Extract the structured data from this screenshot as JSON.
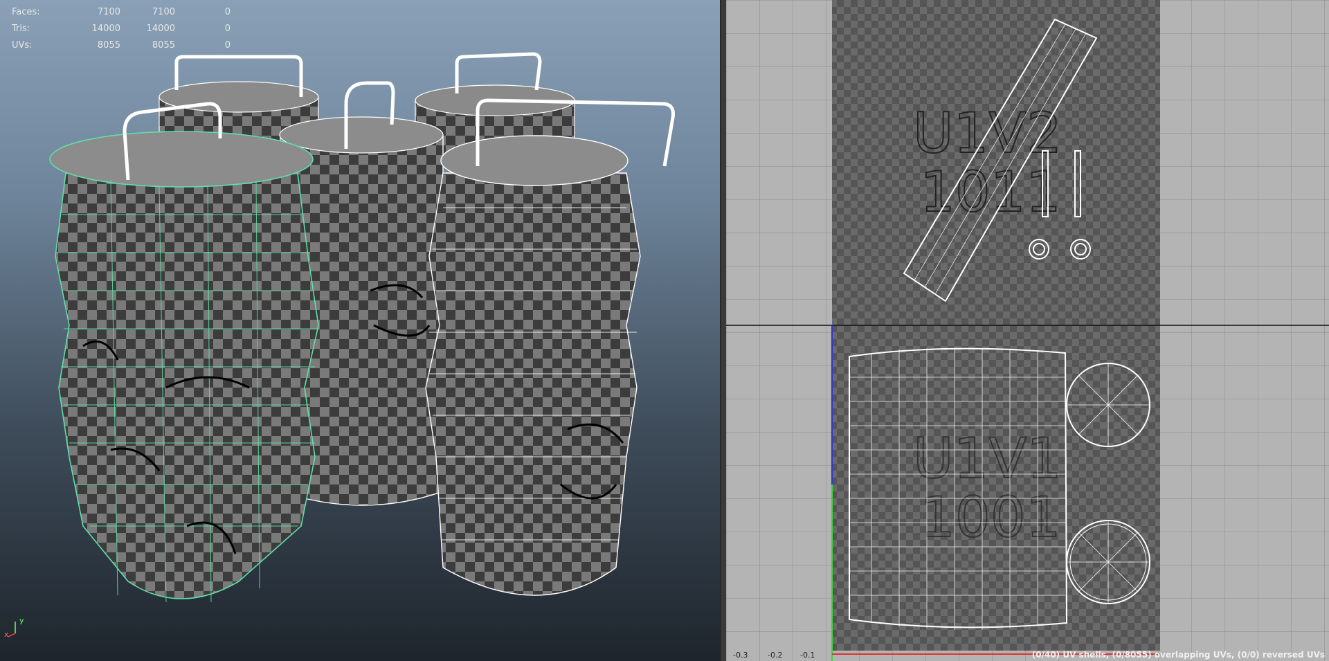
{
  "hud": {
    "rows": [
      {
        "label": "Faces:",
        "a": "7100",
        "b": "7100",
        "c": "0"
      },
      {
        "label": "Tris:",
        "a": "14000",
        "b": "14000",
        "c": "0"
      },
      {
        "label": "UVs:",
        "a": "8055",
        "b": "8055",
        "c": "0"
      }
    ]
  },
  "axis": {
    "x": "x",
    "y": "y"
  },
  "uv_editor": {
    "tiles": [
      {
        "line1": "U1V2",
        "line2": "1011"
      },
      {
        "line1": "U1V1",
        "line2": "1001"
      }
    ],
    "ticks": [
      "-0.3",
      "-0.2",
      "-0.1"
    ],
    "status": "(0/40) UV shells, (0/8055) overlapping UVs, (0/0) reversed UVs"
  },
  "colors": {
    "selection": "#5fe0a8",
    "wire": "#ffffff",
    "checker_dark": "#3c3c3c",
    "checker_light": "#7a7a7a"
  }
}
